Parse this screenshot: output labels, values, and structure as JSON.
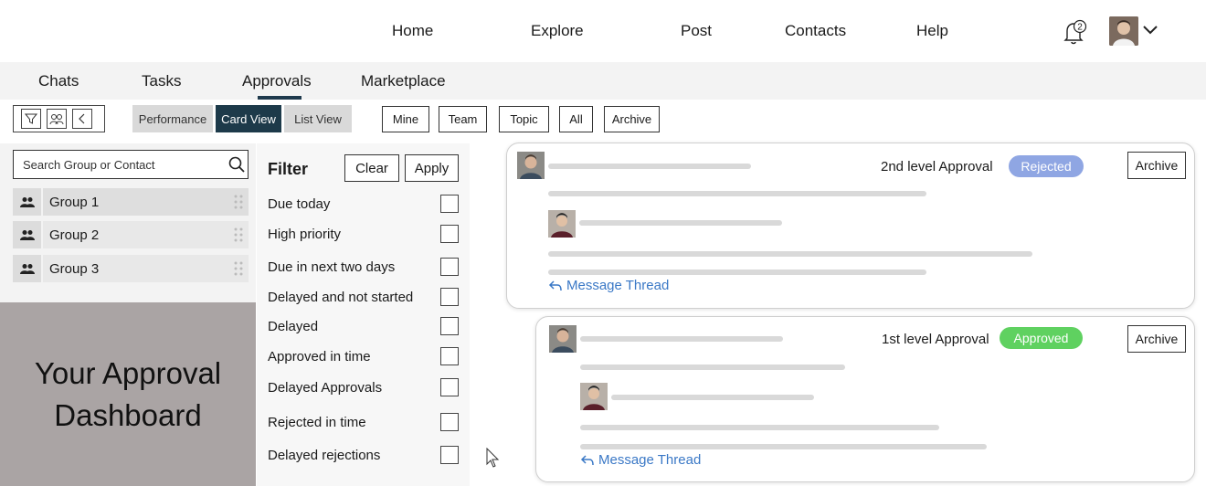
{
  "topnav": {
    "links": [
      "Home",
      "Explore",
      "Post",
      "Contacts",
      "Help"
    ],
    "notification_count": "2",
    "icons": {
      "bell": "bell-icon",
      "profile_menu": "chevron-down-icon"
    }
  },
  "subnav": {
    "tabs": [
      "Chats",
      "Tasks",
      "Approvals",
      "Marketplace"
    ],
    "active_tab": "Approvals"
  },
  "toolbar": {
    "icons": [
      "filter-icon",
      "people-icon",
      "collapse-icon"
    ],
    "views": [
      "Performance",
      "Card View",
      "List View"
    ],
    "active_view": "Card View",
    "scopes": [
      "Mine",
      "Team",
      "Topic",
      "All",
      "Archive"
    ]
  },
  "sidebar": {
    "search_placeholder": "Search Group or Contact",
    "groups": [
      {
        "label": "Group 1"
      },
      {
        "label": "Group 2"
      },
      {
        "label": "Group 3"
      }
    ],
    "promo": "Your Approval Dashboard"
  },
  "filter": {
    "title": "Filter",
    "clear_label": "Clear",
    "apply_label": "Apply",
    "options": [
      "Due today",
      "High priority",
      "Due in next two days",
      "Delayed and not started",
      "Delayed",
      "Approved in time",
      "Delayed Approvals",
      "Rejected in time",
      "Delayed rejections"
    ]
  },
  "cards": [
    {
      "level": "2nd level Approval",
      "status": "Rejected",
      "status_color": "#8fa6e3",
      "archive_label": "Archive",
      "thread_label": "Message Thread"
    },
    {
      "level": "1st level Approval",
      "status": "Approved",
      "status_color": "#5fd160",
      "archive_label": "Archive",
      "thread_label": "Message Thread"
    }
  ],
  "colors": {
    "accent_dark": "#1d3a4a",
    "link_blue": "#3a78c6"
  }
}
